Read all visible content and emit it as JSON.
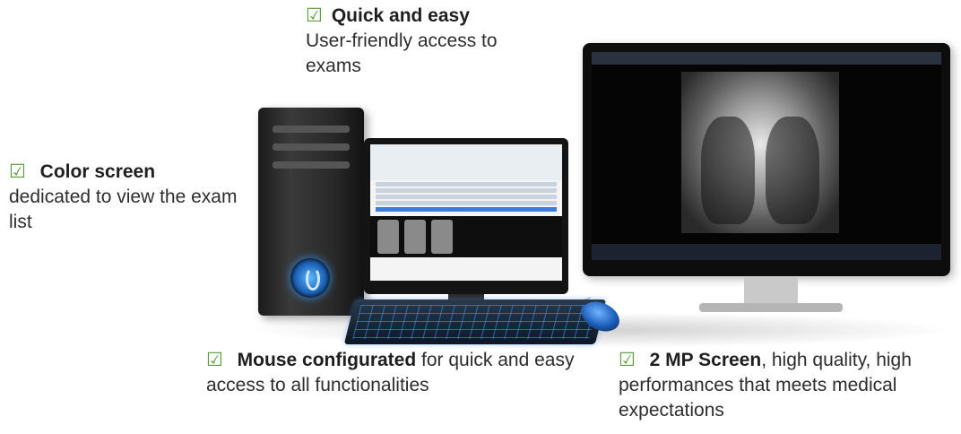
{
  "callouts": {
    "top": {
      "bold": "Quick and easy",
      "rest": "User-friendly access to exams"
    },
    "left": {
      "bold": "Color screen",
      "rest": "dedicated to view the exam list"
    },
    "mouse": {
      "bold": "Mouse configurated",
      "rest": " for quick and easy access to all functionalities"
    },
    "mp": {
      "bold": "2 MP Screen",
      "rest": ", high quality, high performances that meets medical expectations"
    }
  },
  "check_glyph": "☑",
  "colors": {
    "check": "#5a9a3c",
    "accent": "#3b7dd8"
  }
}
